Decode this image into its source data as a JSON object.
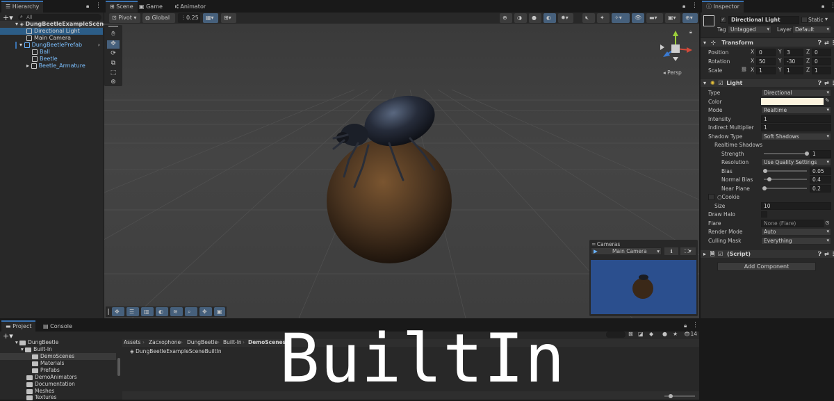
{
  "hierarchy": {
    "tab": "Hierarchy",
    "search_placeholder": "All",
    "scene_name": "DungBeetleExampleScene",
    "items": [
      {
        "label": "Directional Light"
      },
      {
        "label": "Main Camera"
      },
      {
        "label": "DungBeetlePrefab"
      },
      {
        "label": "Ball"
      },
      {
        "label": "Beetle"
      },
      {
        "label": "Beetle_Armature"
      }
    ]
  },
  "view_tabs": {
    "scene": "Scene",
    "game": "Game",
    "animator": "Animator"
  },
  "toolbar": {
    "pivot": "Pivot",
    "global": "Global",
    "snap_value": "0.25"
  },
  "scene": {
    "persp_label": "◂ Persp",
    "cameras_overlay": {
      "title": "Cameras",
      "selected": "Main Camera"
    }
  },
  "inspector": {
    "tab": "Inspector",
    "object_name": "Directional Light",
    "static_label": "Static",
    "tag_label": "Tag",
    "tag_value": "Untagged",
    "layer_label": "Layer",
    "layer_value": "Default",
    "transform": {
      "title": "Transform",
      "position_label": "Position",
      "rotation_label": "Rotation",
      "scale_label": "Scale",
      "position": {
        "x": "0",
        "y": "3",
        "z": "0"
      },
      "rotation": {
        "x": "50",
        "y": "-30",
        "z": "0"
      },
      "scale": {
        "x": "1",
        "y": "1",
        "z": "1"
      }
    },
    "light": {
      "title": "Light",
      "type_label": "Type",
      "type_value": "Directional",
      "color_label": "Color",
      "color_value": "#fdf4df",
      "mode_label": "Mode",
      "mode_value": "Realtime",
      "intensity_label": "Intensity",
      "intensity_value": "1",
      "indirect_label": "Indirect Multiplier",
      "indirect_value": "1",
      "shadow_type_label": "Shadow Type",
      "shadow_type_value": "Soft Shadows",
      "realtime_shadows_label": "Realtime Shadows",
      "strength_label": "Strength",
      "strength_value": "1",
      "strength_fraction": 1.0,
      "resolution_label": "Resolution",
      "resolution_value": "Use Quality Settings",
      "bias_label": "Bias",
      "bias_value": "0.05",
      "bias_fraction": 0.025,
      "normal_bias_label": "Normal Bias",
      "normal_bias_value": "0.4",
      "normal_bias_fraction": 0.13,
      "near_plane_label": "Near Plane",
      "near_plane_value": "0.2",
      "near_plane_fraction": 0.01,
      "cookie_label": "Cookie",
      "size_label": "Size",
      "size_value": "10",
      "draw_halo_label": "Draw Halo",
      "flare_label": "Flare",
      "flare_value": "None (Flare)",
      "render_mode_label": "Render Mode",
      "render_mode_value": "Auto",
      "culling_mask_label": "Culling Mask",
      "culling_mask_value": "Everything"
    },
    "script_label": "(Script)",
    "add_component": "Add Component"
  },
  "project": {
    "tab_project": "Project",
    "tab_console": "Console",
    "tree": [
      {
        "label": "DungBeetle",
        "indent": 0
      },
      {
        "label": "Built-In",
        "indent": 1
      },
      {
        "label": "DemoScenes",
        "indent": 2
      },
      {
        "label": "Materials",
        "indent": 2
      },
      {
        "label": "Prefabs",
        "indent": 2
      },
      {
        "label": "DemoAnimators",
        "indent": 1
      },
      {
        "label": "Documentation",
        "indent": 1
      },
      {
        "label": "Meshes",
        "indent": 1
      },
      {
        "label": "Textures",
        "indent": 1
      }
    ],
    "breadcrumb": [
      "Assets",
      "Zacxophone",
      "DungBeetle",
      "Built-In",
      "DemoScenes"
    ],
    "file": "DungBeetleExampleSceneBuiltIn",
    "hidden_count": "14"
  },
  "overlay_caption": "BuiltIn",
  "colors": {
    "accent": "#3a72b0",
    "selection": "#2c5d87",
    "prefab_blue": "#7cc0ff",
    "camera_bg": "#2b4f8e"
  }
}
